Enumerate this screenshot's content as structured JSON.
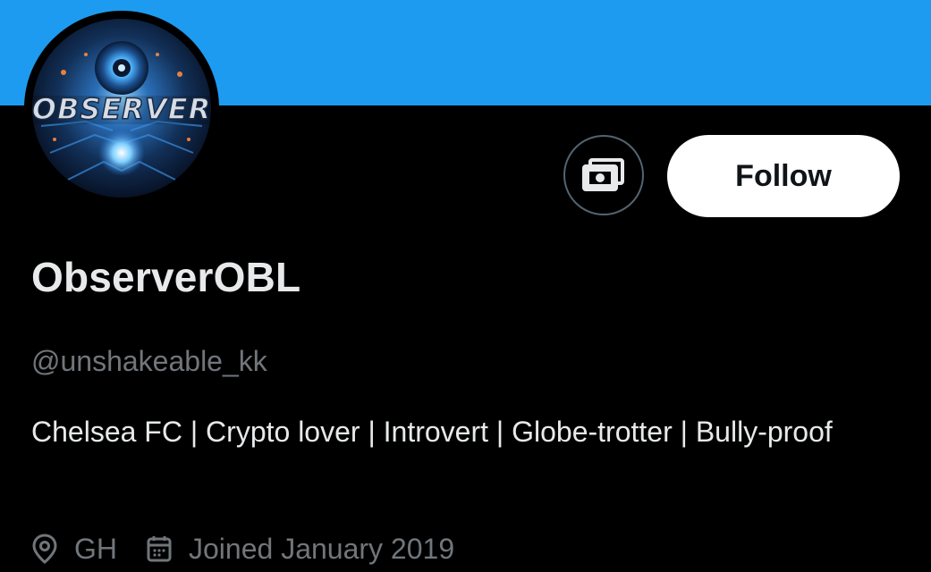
{
  "profile": {
    "display_name": "ObserverOBL",
    "handle": "@unshakeable_kk",
    "bio": "Chelsea FC | Crypto lover | Introvert | Globe-trotter | Bully-proof",
    "avatar_text": "OBSERVER",
    "location": "GH",
    "joined": "Joined January 2019"
  },
  "actions": {
    "follow_label": "Follow",
    "tip_icon": "money-icon"
  },
  "colors": {
    "banner": "#1d9bf0",
    "background": "#000000",
    "primary_text": "#e7e9ea",
    "secondary_text": "#71767b",
    "follow_bg": "#ffffff"
  }
}
